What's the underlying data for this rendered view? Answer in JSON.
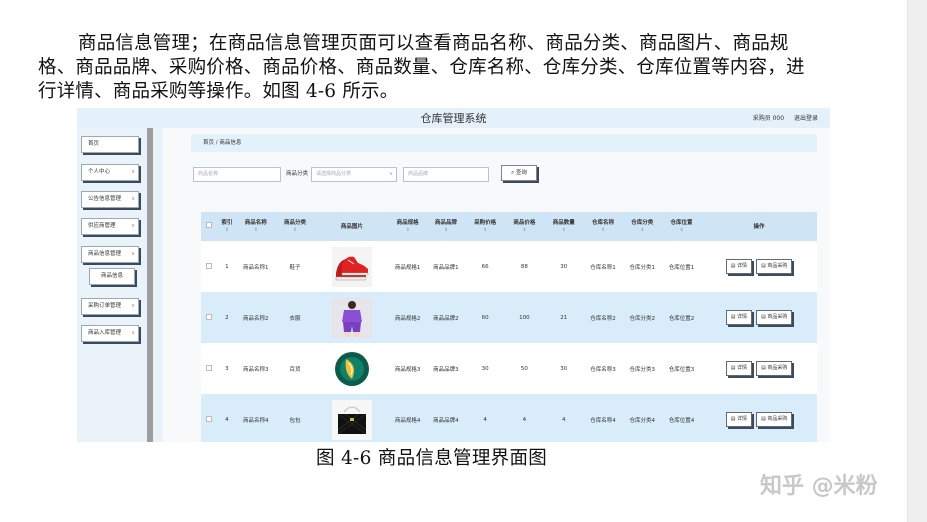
{
  "document": {
    "paragraph": "商品信息管理；在商品信息管理页面可以查看商品名称、商品分类、商品图片、商品规格、商品品牌、采购价格、商品价格、商品数量、仓库名称、仓库分类、仓库位置等内容，进行详情、商品采购等操作。如图 4-6 所示。",
    "caption": "图 4-6 商品信息管理界面图",
    "watermark": "知乎 @米粉"
  },
  "screenshot": {
    "header": {
      "title": "仓库管理系统",
      "user": "采购员 000",
      "logout": "退出登录"
    },
    "sidebar": {
      "items": [
        {
          "label": "首页",
          "has_chevron": false
        },
        {
          "label": "个人中心",
          "has_chevron": true
        },
        {
          "label": "公告信息管理",
          "has_chevron": true
        },
        {
          "label": "供应商管理",
          "has_chevron": true
        },
        {
          "label": "商品信息管理",
          "has_chevron": true
        },
        {
          "label": "商品信息",
          "has_chevron": false
        },
        {
          "label": "采购订单管理",
          "has_chevron": true
        },
        {
          "label": "商品入库管理",
          "has_chevron": true
        }
      ],
      "chevron": "∨"
    },
    "breadcrumb": {
      "home": "首页",
      "separator": "/",
      "current": "商品信息"
    },
    "filters": {
      "name_placeholder": "商品名称",
      "category_label": "商品分类",
      "category_placeholder": "请选择商品分类",
      "brand_placeholder": "商品品牌",
      "search_label": "查询",
      "search_icon": "search-icon"
    },
    "table": {
      "columns": [
        "索引",
        "商品名称",
        "商品分类",
        "商品图片",
        "商品规格",
        "商品品牌",
        "采购价格",
        "商品价格",
        "商品数量",
        "仓库名称",
        "仓库分类",
        "仓库位置",
        "操作"
      ],
      "sort_mark": "⇕",
      "detail_label": "详情",
      "purchase_label": "商品采购",
      "rows": [
        {
          "index": "1",
          "name": "商品名称1",
          "category": "鞋子",
          "image": "red-sneakers",
          "spec": "商品规格1",
          "brand": "商品品牌1",
          "purchase_price": "66",
          "price": "88",
          "qty": "30",
          "wh_name": "仓库名称1",
          "wh_cat": "仓库分类1",
          "wh_loc": "仓库位置1"
        },
        {
          "index": "2",
          "name": "商品名称2",
          "category": "衣服",
          "image": "purple-outfit",
          "spec": "商品规格2",
          "brand": "商品品牌2",
          "purchase_price": "60",
          "price": "100",
          "qty": "21",
          "wh_name": "仓库名称2",
          "wh_cat": "仓库分类2",
          "wh_loc": "仓库位置2"
        },
        {
          "index": "3",
          "name": "商品名称3",
          "category": "百货",
          "image": "green-bag",
          "spec": "商品规格3",
          "brand": "商品品牌3",
          "purchase_price": "30",
          "price": "50",
          "qty": "30",
          "wh_name": "仓库名称3",
          "wh_cat": "仓库分类3",
          "wh_loc": "仓库位置3"
        },
        {
          "index": "4",
          "name": "商品名称4",
          "category": "包包",
          "image": "black-handbag",
          "spec": "商品规格4",
          "brand": "商品品牌4",
          "purchase_price": "4",
          "price": "4",
          "qty": "4",
          "wh_name": "仓库名称4",
          "wh_cat": "仓库分类4",
          "wh_loc": "仓库位置4"
        }
      ]
    }
  },
  "colors": {
    "header_bg": "#e4f0fa",
    "table_header": "#cfe4f5",
    "row_alt": "#d8ecfa",
    "button_shadow": "#3c4a5a"
  }
}
